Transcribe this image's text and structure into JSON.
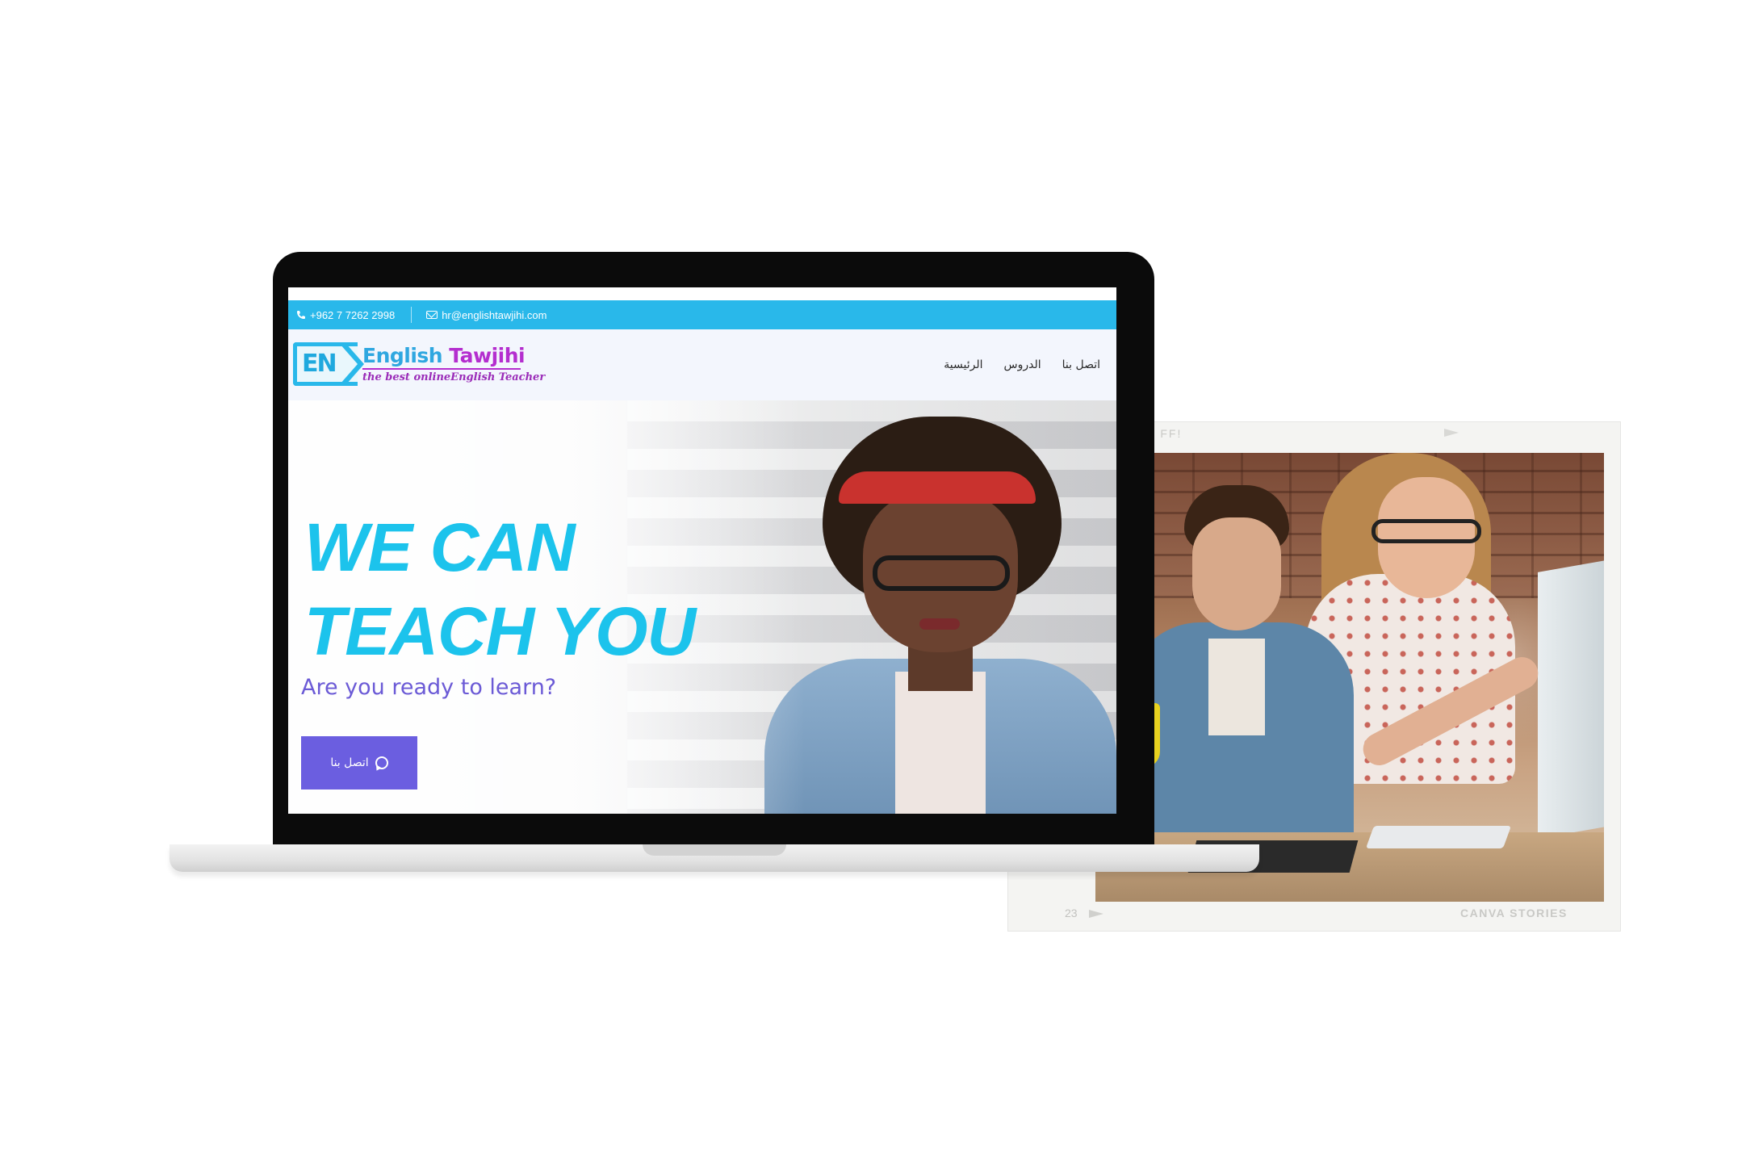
{
  "website": {
    "topbar": {
      "phone": "+962 7 7262 2998",
      "email": "hr@englishtawjihi.com"
    },
    "logo": {
      "mark": "EN",
      "title_part1": "English ",
      "title_part2": "Tawjihi",
      "tagline": "the best onlineEnglish Teacher"
    },
    "nav": {
      "items": [
        "اتصل بنا",
        "الدروس",
        "الرئيسية"
      ]
    },
    "hero": {
      "title": "WE CAN\nTEACH YOU",
      "subtitle": "Are you ready to learn?",
      "button_label": "اتصل بنا",
      "button_icon": "whatsapp-icon"
    }
  },
  "film_frame": {
    "bottom_number": "23",
    "brand": "CANVA STORIES"
  },
  "colors": {
    "topbar": "#29b8ea",
    "hero_title": "#1cc3ec",
    "subtitle": "#6b5ad6",
    "button": "#6b5ee0",
    "logo_accent": "#b42ecf"
  }
}
